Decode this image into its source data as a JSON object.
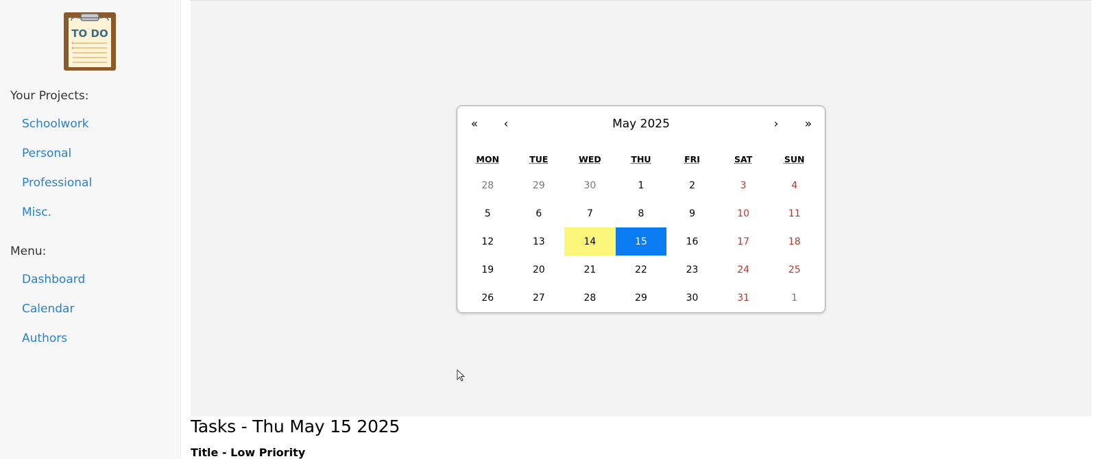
{
  "sidebar": {
    "logo_text": "TO DO",
    "projects_label": "Your Projects:",
    "projects": [
      {
        "label": "Schoolwork"
      },
      {
        "label": "Personal"
      },
      {
        "label": "Professional"
      },
      {
        "label": "Misc."
      }
    ],
    "menu_label": "Menu:",
    "menu": [
      {
        "label": "Dashboard"
      },
      {
        "label": "Calendar"
      },
      {
        "label": "Authors"
      }
    ]
  },
  "calendar": {
    "title": "May 2025",
    "nav": {
      "prev_year": "«",
      "prev_month": "‹",
      "next_month": "›",
      "next_year": "»"
    },
    "weekdays": [
      "MON",
      "TUE",
      "WED",
      "THU",
      "FRI",
      "SAT",
      "SUN"
    ],
    "weeks": [
      [
        {
          "d": "28",
          "type": "other"
        },
        {
          "d": "29",
          "type": "other"
        },
        {
          "d": "30",
          "type": "other"
        },
        {
          "d": "1",
          "type": "normal"
        },
        {
          "d": "2",
          "type": "normal"
        },
        {
          "d": "3",
          "type": "weekend"
        },
        {
          "d": "4",
          "type": "weekend"
        }
      ],
      [
        {
          "d": "5",
          "type": "normal"
        },
        {
          "d": "6",
          "type": "normal"
        },
        {
          "d": "7",
          "type": "normal"
        },
        {
          "d": "8",
          "type": "normal"
        },
        {
          "d": "9",
          "type": "normal"
        },
        {
          "d": "10",
          "type": "weekend"
        },
        {
          "d": "11",
          "type": "weekend"
        }
      ],
      [
        {
          "d": "12",
          "type": "normal"
        },
        {
          "d": "13",
          "type": "normal"
        },
        {
          "d": "14",
          "type": "today"
        },
        {
          "d": "15",
          "type": "active"
        },
        {
          "d": "16",
          "type": "normal"
        },
        {
          "d": "17",
          "type": "weekend"
        },
        {
          "d": "18",
          "type": "weekend"
        }
      ],
      [
        {
          "d": "19",
          "type": "normal"
        },
        {
          "d": "20",
          "type": "normal"
        },
        {
          "d": "21",
          "type": "normal"
        },
        {
          "d": "22",
          "type": "normal"
        },
        {
          "d": "23",
          "type": "normal"
        },
        {
          "d": "24",
          "type": "weekend"
        },
        {
          "d": "25",
          "type": "weekend"
        }
      ],
      [
        {
          "d": "26",
          "type": "normal"
        },
        {
          "d": "27",
          "type": "normal"
        },
        {
          "d": "28",
          "type": "normal"
        },
        {
          "d": "29",
          "type": "normal"
        },
        {
          "d": "30",
          "type": "normal"
        },
        {
          "d": "31",
          "type": "weekend"
        },
        {
          "d": "1",
          "type": "other"
        }
      ]
    ],
    "colors": {
      "today_highlight": "#fbf57a",
      "active_highlight": "#0a7bf0",
      "weekend_text": "#b03a2e",
      "other_month_text": "#777777"
    }
  },
  "tasks": {
    "heading": "Tasks - Thu May 15 2025",
    "first_task_title": "Title - Low Priority"
  },
  "colors": {
    "link": "#2a7fc9",
    "sidebar_bg": "#f7f7f7",
    "calendar_panel_bg": "#f3f3f3"
  }
}
